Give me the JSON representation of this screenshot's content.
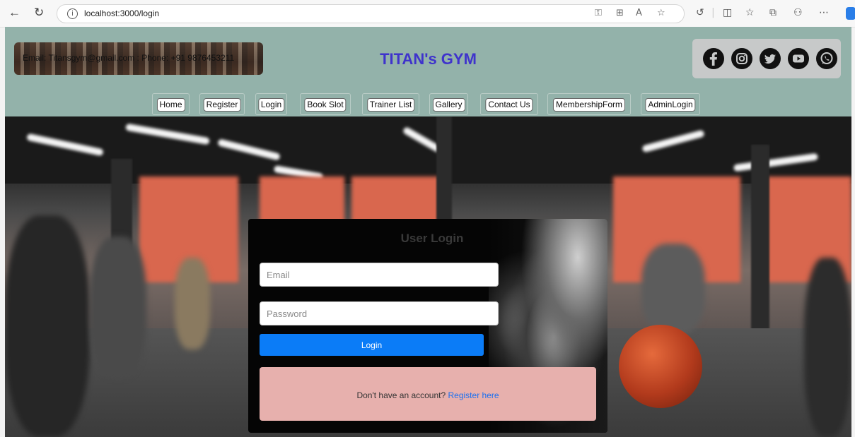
{
  "browser": {
    "back_icon": "arrow-left-icon",
    "refresh_icon": "refresh-icon",
    "info_icon": "info-icon",
    "url": "localhost:3000/login"
  },
  "header": {
    "contact_text": "Email: Titansgym@gmail.com : Phone: +91 9876453211",
    "brand_title": "TITAN's GYM",
    "brand_color": "#3f33cc",
    "header_bg": "#93b2aa",
    "social_icons": [
      "facebook-icon",
      "instagram-icon",
      "twitter-icon",
      "youtube-icon",
      "whatsapp-icon"
    ]
  },
  "nav": {
    "items": [
      {
        "label": "Home"
      },
      {
        "label": "Register"
      },
      {
        "label": "Login"
      },
      {
        "label": "Book Slot"
      },
      {
        "label": "Trainer List"
      },
      {
        "label": "Gallery"
      },
      {
        "label": "Contact Us"
      },
      {
        "label": "MembershipForm"
      },
      {
        "label": "AdminLogin"
      }
    ]
  },
  "login": {
    "title": "User Login",
    "email_placeholder": "Email",
    "email_value": "",
    "password_placeholder": "Password",
    "password_value": "",
    "button_label": "Login",
    "button_color": "#0b7cf7",
    "register_prompt": "Don't have an account?",
    "register_link": "Register here",
    "register_box_color": "#e7b0ad"
  }
}
